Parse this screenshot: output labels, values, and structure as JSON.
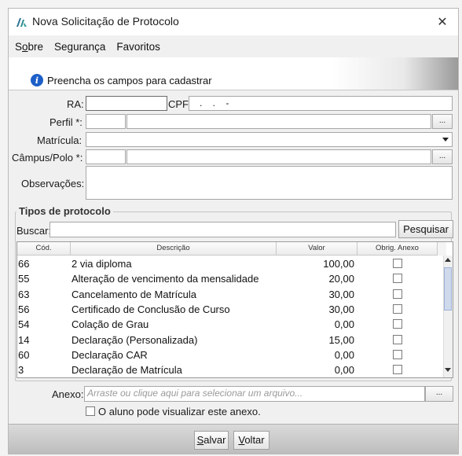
{
  "window": {
    "title": "Nova Solicitação de Protocolo",
    "close_glyph": "✕"
  },
  "menu": {
    "items": [
      {
        "label_prefix": "S",
        "label_underlined": "o",
        "label_rest": "bre"
      },
      {
        "label": "Segurança"
      },
      {
        "label": "Favoritos"
      }
    ]
  },
  "info": {
    "icon": "info-icon",
    "text": "Preencha os campos para cadastrar"
  },
  "form": {
    "ra_label": "RA:",
    "ra_value": "",
    "cpf_label": "CPF:",
    "cpf_value": "   .    .    -",
    "perfil_label": "Perfil *:",
    "matricula_label": "Matrícula:",
    "campus_label": "Câmpus/Polo *:",
    "obs_label": "Observações:",
    "dots_label": "..."
  },
  "tipos": {
    "group_title": "Tipos de protocolo",
    "buscar_label": "Buscar:",
    "buscar_value": "",
    "pesquisar_label": "Pesquisar",
    "columns": [
      "Cód.",
      "Descrição",
      "Valor",
      "Obrig. Anexo"
    ],
    "rows": [
      {
        "cod": "66",
        "desc": "2 via diploma",
        "valor": "100,00",
        "anexo": false
      },
      {
        "cod": "55",
        "desc": "Alteração de vencimento da mensalidade",
        "valor": "20,00",
        "anexo": false
      },
      {
        "cod": "63",
        "desc": "Cancelamento de Matrícula",
        "valor": "30,00",
        "anexo": false
      },
      {
        "cod": "56",
        "desc": "Certificado de Conclusão de Curso",
        "valor": "30,00",
        "anexo": false
      },
      {
        "cod": "54",
        "desc": "Colação de Grau",
        "valor": "0,00",
        "anexo": false
      },
      {
        "cod": "14",
        "desc": "Declaração (Personalizada)",
        "valor": "15,00",
        "anexo": false
      },
      {
        "cod": "60",
        "desc": "Declaração CAR",
        "valor": "0,00",
        "anexo": false
      },
      {
        "cod": "3",
        "desc": "Declaração de Matrícula",
        "valor": "0,00",
        "anexo": false
      }
    ]
  },
  "anexo": {
    "label": "Anexo:",
    "placeholder": "Arraste ou clique aqui para selecionar um arquivo...",
    "dots_label": "...",
    "visivel_label": "O aluno pode visualizar este anexo.",
    "visivel_checked": false
  },
  "footer": {
    "salvar_prefix": "",
    "salvar_underlined": "S",
    "salvar_rest": "alvar",
    "voltar_underlined": "V",
    "voltar_rest": "oltar"
  },
  "colors": {
    "info_blue": "#1d5fc7",
    "logo_teal": "#2a8a8a"
  }
}
